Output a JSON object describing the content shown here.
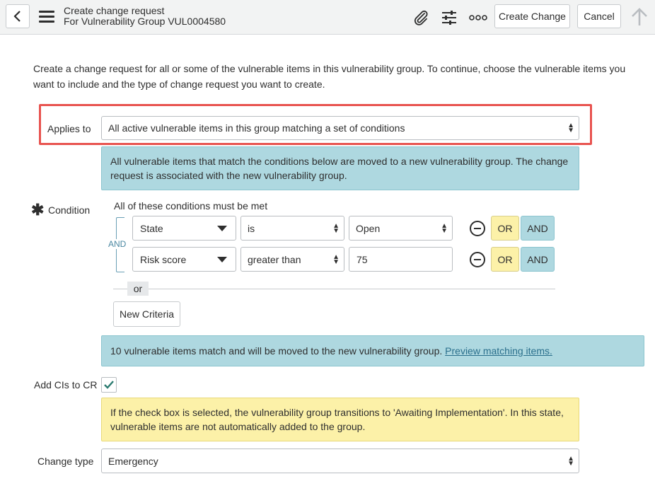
{
  "header": {
    "title": "Create change request",
    "subtitle": "For Vulnerability Group VUL0004580",
    "create_label": "Create Change",
    "cancel_label": "Cancel"
  },
  "intro_text": "Create a change request for all or some of the vulnerable items in this vulnerability group. To continue, choose the vulnerable items you want to include and the type of change request you want to create.",
  "applies_to": {
    "label": "Applies to",
    "value": "All active vulnerable items in this group matching a set of conditions",
    "info": "All vulnerable items that match the conditions below are moved to a new vulnerability group. The change request is associated with the new vulnerability group."
  },
  "condition": {
    "label": "Condition",
    "header": "All of these conditions must be met",
    "and_label": "AND",
    "rows": [
      {
        "field": "State",
        "operator": "is",
        "value": "Open"
      },
      {
        "field": "Risk score",
        "operator": "greater than",
        "value": "75"
      }
    ],
    "or_label": "OR",
    "and_button_label": "AND",
    "or_separator": "or",
    "new_criteria_label": "New Criteria"
  },
  "match_info": {
    "text": "10 vulnerable items match and will be moved to the new vulnerability group.",
    "link": "Preview matching items."
  },
  "add_cis": {
    "label": "Add CIs to CR",
    "checked": true,
    "info": "If the check box is selected, the vulnerability group transitions to 'Awaiting Implementation'. In this state, vulnerable items are not automatically added to the group."
  },
  "change_type": {
    "label": "Change type",
    "value": "Emergency"
  },
  "colors": {
    "info_blue": "#aed8e0",
    "info_yellow": "#fcf1a8",
    "highlight": "#e8534f",
    "check": "#2a7a6f"
  }
}
